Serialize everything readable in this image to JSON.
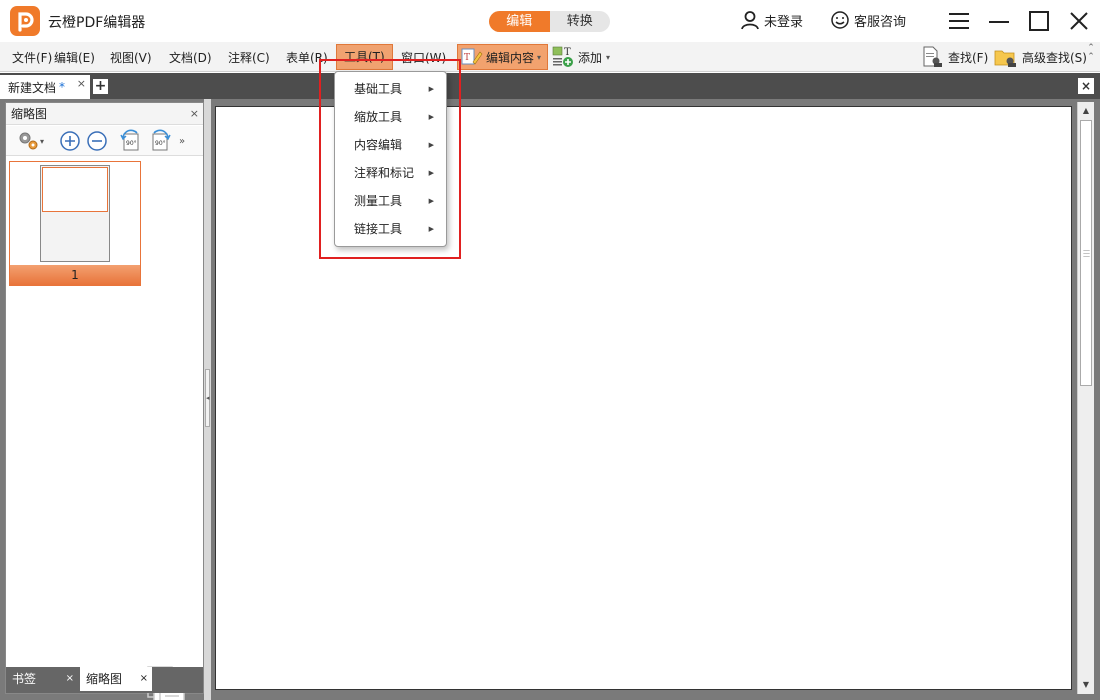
{
  "window": {
    "title": "云橙PDF编辑器",
    "mode_tabs": [
      {
        "label": "编辑",
        "active": true
      },
      {
        "label": "转换",
        "active": false
      }
    ],
    "login_label": "未登录",
    "support_label": "客服咨询"
  },
  "menubar": {
    "items": [
      {
        "label": "文件(F)"
      },
      {
        "label": "编辑(E)"
      },
      {
        "label": "视图(V)"
      },
      {
        "label": "文档(D)"
      },
      {
        "label": "注释(C)"
      },
      {
        "label": "表单(R)"
      },
      {
        "label": "工具(T)",
        "selected": true
      },
      {
        "label": "窗口(W)"
      }
    ],
    "edit_content_label": "编辑内容",
    "add_label": "添加",
    "find_label": "查找(F)",
    "advanced_find_label": "高级查找(S)"
  },
  "tabs": {
    "doc_tab_label": "新建文档",
    "modified_marker": "*",
    "close_glyph": "×",
    "new_tab_glyph": "+",
    "close_all_glyph": "×"
  },
  "sidepanel": {
    "title": "缩略图",
    "close_glyph": "×",
    "page_number": "1",
    "bottom_tabs": [
      {
        "label": "书签"
      },
      {
        "label": "缩略图"
      }
    ]
  },
  "tools_menu": {
    "items": [
      {
        "label": "基础工具"
      },
      {
        "label": "缩放工具"
      },
      {
        "label": "内容编辑"
      },
      {
        "label": "注释和标记"
      },
      {
        "label": "测量工具"
      },
      {
        "label": "链接工具"
      }
    ]
  },
  "colors": {
    "accent": "#f07a2a",
    "highlight_box": "#e02020",
    "workspace_bg": "#7a7a7a"
  }
}
